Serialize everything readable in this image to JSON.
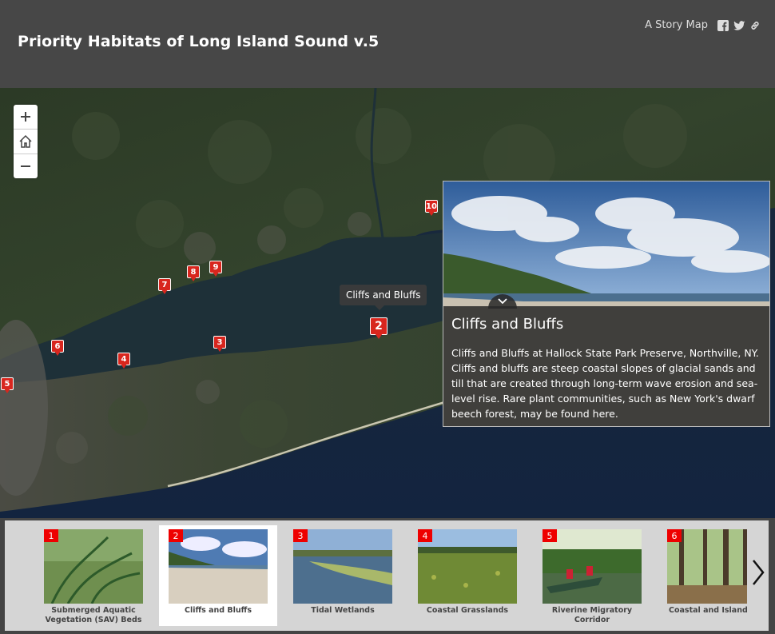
{
  "header": {
    "title": "Priority Habitats of Long Island Sound v.5",
    "story_map_label": "A Story Map",
    "icons": [
      "facebook-icon",
      "twitter-icon",
      "link-icon"
    ]
  },
  "map": {
    "zoom_controls": [
      "zoom-in-icon",
      "home-icon",
      "zoom-out-icon"
    ],
    "markers": [
      "2",
      "3",
      "4",
      "5",
      "6",
      "7",
      "8",
      "9",
      "10"
    ],
    "tooltip": "Cliffs and Bluffs"
  },
  "panel": {
    "title": "Cliffs and Bluffs",
    "description": "Cliffs and Bluffs at Hallock State Park Preserve, Northville, NY. Cliffs and bluffs are steep coastal slopes of glacial sands and till that are created through long-term wave erosion and sea-level rise. Rare plant communities, such as New York's dwarf beech forest, may be found here."
  },
  "carousel": {
    "items": [
      {
        "num": "1",
        "caption": "Submerged Aquatic Vegetation (SAV) Beds"
      },
      {
        "num": "2",
        "caption": "Cliffs and Bluffs"
      },
      {
        "num": "3",
        "caption": "Tidal Wetlands"
      },
      {
        "num": "4",
        "caption": "Coastal Grasslands"
      },
      {
        "num": "5",
        "caption": "Riverine Migratory Corridor"
      },
      {
        "num": "6",
        "caption": "Coastal and Island F"
      }
    ],
    "active": "2"
  },
  "colors": {
    "header_bg": "#474747",
    "marker_red": "#d8261e",
    "carousel_bg": "#d5d5d5"
  }
}
